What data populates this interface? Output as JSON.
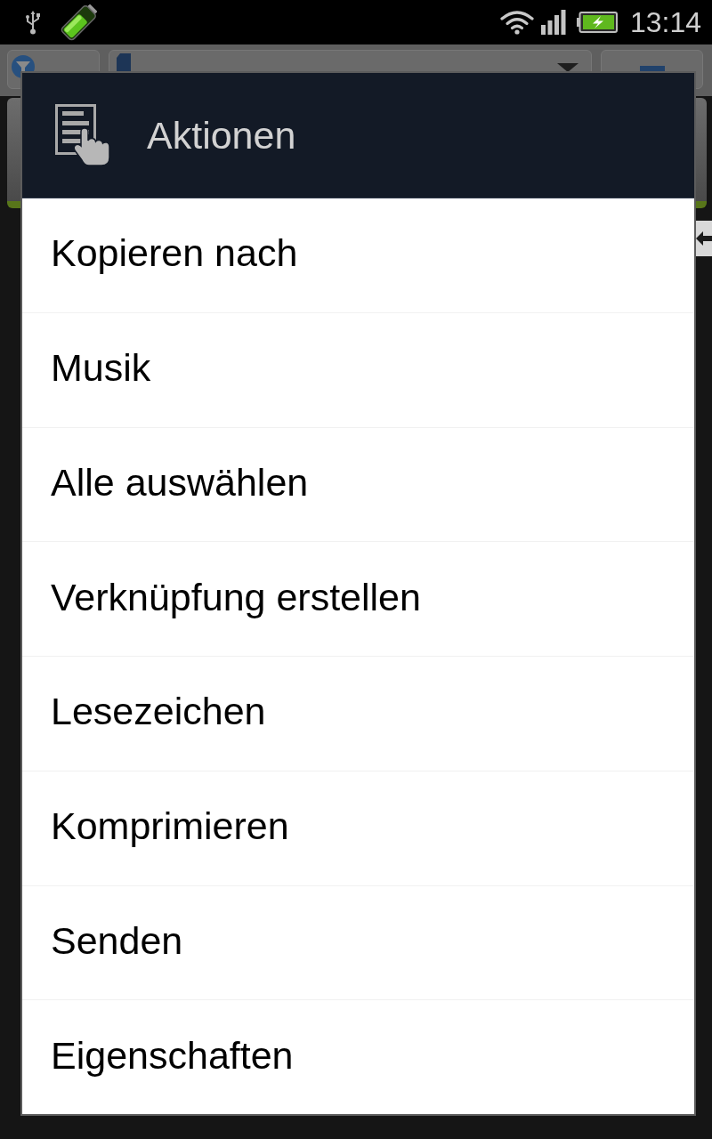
{
  "status_bar": {
    "time": "13:14"
  },
  "dialog": {
    "title": "Aktionen",
    "items": [
      "Kopieren nach",
      "Musik",
      "Alle auswählen",
      "Verknüpfung erstellen",
      "Lesezeichen",
      "Komprimieren",
      "Senden",
      "Eigenschaften"
    ]
  }
}
